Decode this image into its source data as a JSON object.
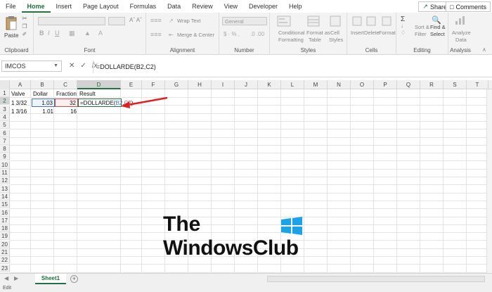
{
  "menu": {
    "items": [
      "File",
      "Home",
      "Insert",
      "Page Layout",
      "Formulas",
      "Data",
      "Review",
      "View",
      "Developer",
      "Help"
    ],
    "active": "Home",
    "share_label": "Share",
    "comments_label": "Comments"
  },
  "ribbon": {
    "clipboard": {
      "label": "Clipboard",
      "paste": "Paste"
    },
    "font": {
      "label": "Font"
    },
    "alignment": {
      "label": "Alignment",
      "wrap_text": "Wrap Text",
      "merge_center": "Merge & Center"
    },
    "number": {
      "label": "Number",
      "format": "General"
    },
    "styles": {
      "label": "Styles",
      "conditional": "Conditional",
      "formatting": "Formatting",
      "format_as": "Format as",
      "table": "Table",
      "cell": "Cell",
      "cell_styles": "Styles"
    },
    "cells": {
      "label": "Cells",
      "insert": "Insert",
      "delete": "Delete",
      "format": "Format"
    },
    "editing": {
      "label": "Editing",
      "sort": "Sort &",
      "filter": "Filter",
      "find": "Find &",
      "select": "Select"
    },
    "analysis": {
      "label": "Analysis",
      "analyze": "Analyze",
      "data": "Data"
    }
  },
  "formula_bar": {
    "name_box": "IMCOS",
    "formula": "=DOLLARDE(B2,C2)"
  },
  "columns": [
    "A",
    "B",
    "C",
    "D",
    "E",
    "F",
    "G",
    "H",
    "I",
    "J",
    "K",
    "L",
    "M",
    "N",
    "O",
    "P",
    "Q",
    "R",
    "S",
    "T"
  ],
  "rows": [
    "1",
    "2",
    "3",
    "4",
    "5",
    "6",
    "7",
    "8",
    "9",
    "10",
    "11",
    "12",
    "13",
    "14",
    "15",
    "16",
    "17",
    "18",
    "19",
    "20",
    "21",
    "22",
    "23"
  ],
  "cells": {
    "a1": "Valve",
    "b1": "Dollar",
    "c1": "Fraction",
    "d1": "Result",
    "a2": "1  3/32",
    "b2": "1.03",
    "c2": "32",
    "d2_prefix": "=DOLLARDE(",
    "d2_ref1": "B2",
    "d2_comma": ",",
    "d2_ref2": "C2",
    "d2_suffix": ")",
    "a3": "1  3/16",
    "b3": "1.01",
    "c3": "16"
  },
  "sheet_tab": "Sheet1",
  "status": "Edit",
  "watermark": {
    "line1": "The",
    "line2": "WindowsClub"
  },
  "colors": {
    "accent": "#217346",
    "ref_blue": "#4472c4",
    "ref_red": "#c0504d",
    "arrow": "#e02020"
  }
}
